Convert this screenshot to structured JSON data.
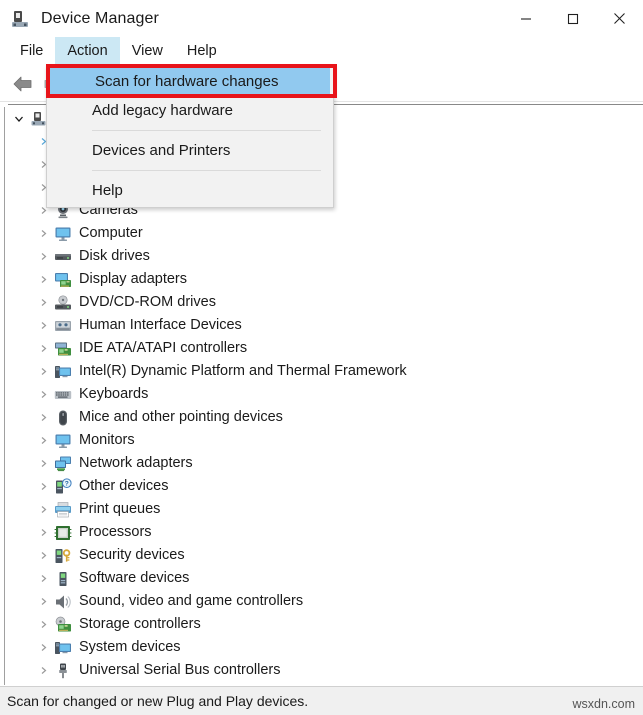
{
  "window": {
    "title": "Device Manager",
    "icon": "device-manager-icon",
    "controls": {
      "minimize": "Minimize",
      "maximize": "Maximize",
      "close": "Close"
    }
  },
  "menubar": {
    "items": [
      {
        "label": "File",
        "active": false
      },
      {
        "label": "Action",
        "active": true
      },
      {
        "label": "View",
        "active": false
      },
      {
        "label": "Help",
        "active": false
      }
    ]
  },
  "toolbar": {
    "back_icon": "back-arrow-icon",
    "forward_icon": "forward-arrow-icon"
  },
  "action_menu": {
    "items": [
      {
        "label": "Scan for hardware changes",
        "highlighted": true,
        "separator_after": false
      },
      {
        "label": "Add legacy hardware",
        "highlighted": false,
        "separator_after": true
      },
      {
        "label": "Devices and Printers",
        "highlighted": false,
        "separator_after": true
      },
      {
        "label": "Help",
        "highlighted": false,
        "separator_after": false
      }
    ]
  },
  "annotation": {
    "color": "#e8141a",
    "target": "Scan for hardware changes"
  },
  "tree": {
    "root": {
      "label": "",
      "icon": "computer-root-icon",
      "expanded": true
    },
    "items": [
      {
        "label": "",
        "icon": "hidden-icon",
        "expanded": false,
        "hidden": true
      },
      {
        "label": "",
        "icon": "hidden-icon",
        "expanded": false,
        "hidden": true
      },
      {
        "label": "",
        "icon": "hidden-icon",
        "expanded": false,
        "hidden": true
      },
      {
        "label": "Cameras",
        "icon": "camera-icon",
        "expanded": false,
        "hidden": false
      },
      {
        "label": "Computer",
        "icon": "monitor-icon",
        "expanded": false,
        "hidden": false
      },
      {
        "label": "Disk drives",
        "icon": "disk-drive-icon",
        "expanded": false,
        "hidden": false
      },
      {
        "label": "Display adapters",
        "icon": "display-adapter-icon",
        "expanded": false,
        "hidden": false
      },
      {
        "label": "DVD/CD-ROM drives",
        "icon": "dvd-drive-icon",
        "expanded": false,
        "hidden": false
      },
      {
        "label": "Human Interface Devices",
        "icon": "hid-icon",
        "expanded": false,
        "hidden": false
      },
      {
        "label": "IDE ATA/ATAPI controllers",
        "icon": "ide-controller-icon",
        "expanded": false,
        "hidden": false
      },
      {
        "label": "Intel(R) Dynamic Platform and Thermal Framework",
        "icon": "system-device-icon",
        "expanded": false,
        "hidden": false
      },
      {
        "label": "Keyboards",
        "icon": "keyboard-icon",
        "expanded": false,
        "hidden": false
      },
      {
        "label": "Mice and other pointing devices",
        "icon": "mouse-icon",
        "expanded": false,
        "hidden": false
      },
      {
        "label": "Monitors",
        "icon": "monitor-icon",
        "expanded": false,
        "hidden": false
      },
      {
        "label": "Network adapters",
        "icon": "network-adapter-icon",
        "expanded": false,
        "hidden": false
      },
      {
        "label": "Other devices",
        "icon": "other-device-icon",
        "expanded": false,
        "hidden": false
      },
      {
        "label": "Print queues",
        "icon": "printer-icon",
        "expanded": false,
        "hidden": false
      },
      {
        "label": "Processors",
        "icon": "processor-icon",
        "expanded": false,
        "hidden": false
      },
      {
        "label": "Security devices",
        "icon": "security-device-icon",
        "expanded": false,
        "hidden": false
      },
      {
        "label": "Software devices",
        "icon": "software-device-icon",
        "expanded": false,
        "hidden": false
      },
      {
        "label": "Sound, video and game controllers",
        "icon": "speaker-icon",
        "expanded": false,
        "hidden": false
      },
      {
        "label": "Storage controllers",
        "icon": "storage-controller-icon",
        "expanded": false,
        "hidden": false
      },
      {
        "label": "System devices",
        "icon": "system-device-icon",
        "expanded": false,
        "hidden": false
      },
      {
        "label": "Universal Serial Bus controllers",
        "icon": "usb-icon",
        "expanded": false,
        "hidden": false
      }
    ]
  },
  "statusbar": {
    "text": "Scan for changed or new Plug and Play devices.",
    "watermark": "wsxdn.com"
  }
}
